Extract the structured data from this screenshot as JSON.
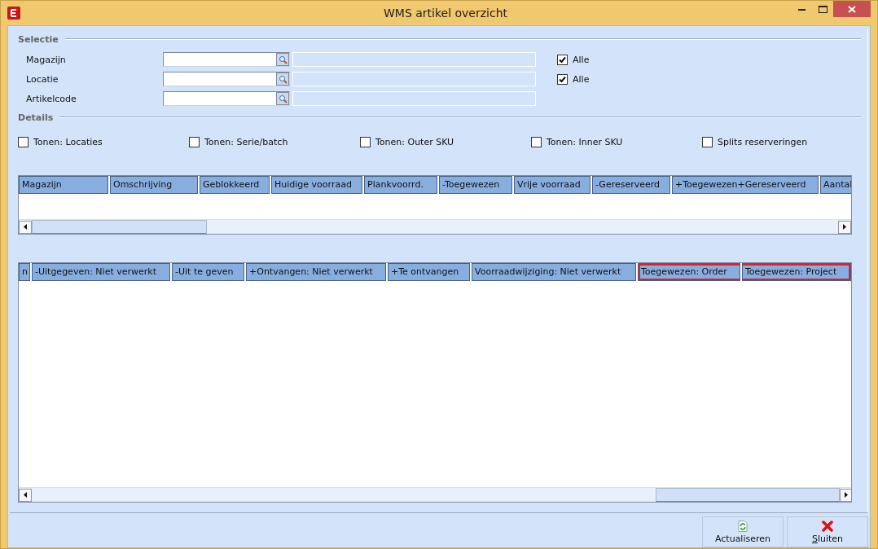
{
  "window": {
    "title": "WMS artikel overzicht"
  },
  "selection": {
    "title": "Selectie",
    "rows": [
      {
        "label": "Magazijn",
        "all": {
          "label": "Alle",
          "checked": true
        }
      },
      {
        "label": "Locatie",
        "all": {
          "label": "Alle",
          "checked": true
        }
      },
      {
        "label": "Artikelcode"
      }
    ]
  },
  "details": {
    "title": "Details",
    "options": [
      {
        "label": "Tonen: Locaties",
        "checked": false
      },
      {
        "label": "Tonen: Serie/batch",
        "checked": false
      },
      {
        "label": "Tonen: Outer SKU",
        "checked": false
      },
      {
        "label": "Tonen: Inner SKU",
        "checked": false
      },
      {
        "label": "Splits reserveringen",
        "checked": false
      }
    ]
  },
  "grid_top": {
    "columns": [
      {
        "label": "Magazijn"
      },
      {
        "label": "Omschrijving"
      },
      {
        "label": "Geblokkeerd"
      },
      {
        "label": "Huidige voorraad"
      },
      {
        "label": "Plankvoorrd."
      },
      {
        "label": "-Toegewezen"
      },
      {
        "label": "Vrije voorraad"
      },
      {
        "label": "-Gereserveerd"
      },
      {
        "label": "+Toegewezen+Gereserveerd"
      },
      {
        "label": "Aantal"
      }
    ]
  },
  "grid_bottom": {
    "columns": [
      {
        "label": "n",
        "highlighted": false
      },
      {
        "label": "-Uitgegeven: Niet verwerkt",
        "highlighted": false
      },
      {
        "label": "-Uit te geven",
        "highlighted": false
      },
      {
        "label": "+Ontvangen: Niet verwerkt",
        "highlighted": false
      },
      {
        "label": "+Te ontvangen",
        "highlighted": false
      },
      {
        "label": "Voorraadwijziging: Niet verwerkt",
        "highlighted": false
      },
      {
        "label": "Toegewezen: Order",
        "highlighted": true
      },
      {
        "label": "Toegewezen: Project",
        "highlighted": true
      }
    ]
  },
  "buttons": [
    {
      "label": "Actualiseren",
      "kind": "refresh"
    },
    {
      "label": "Sluiten",
      "kind": "close",
      "access_key_underlined": true
    }
  ]
}
